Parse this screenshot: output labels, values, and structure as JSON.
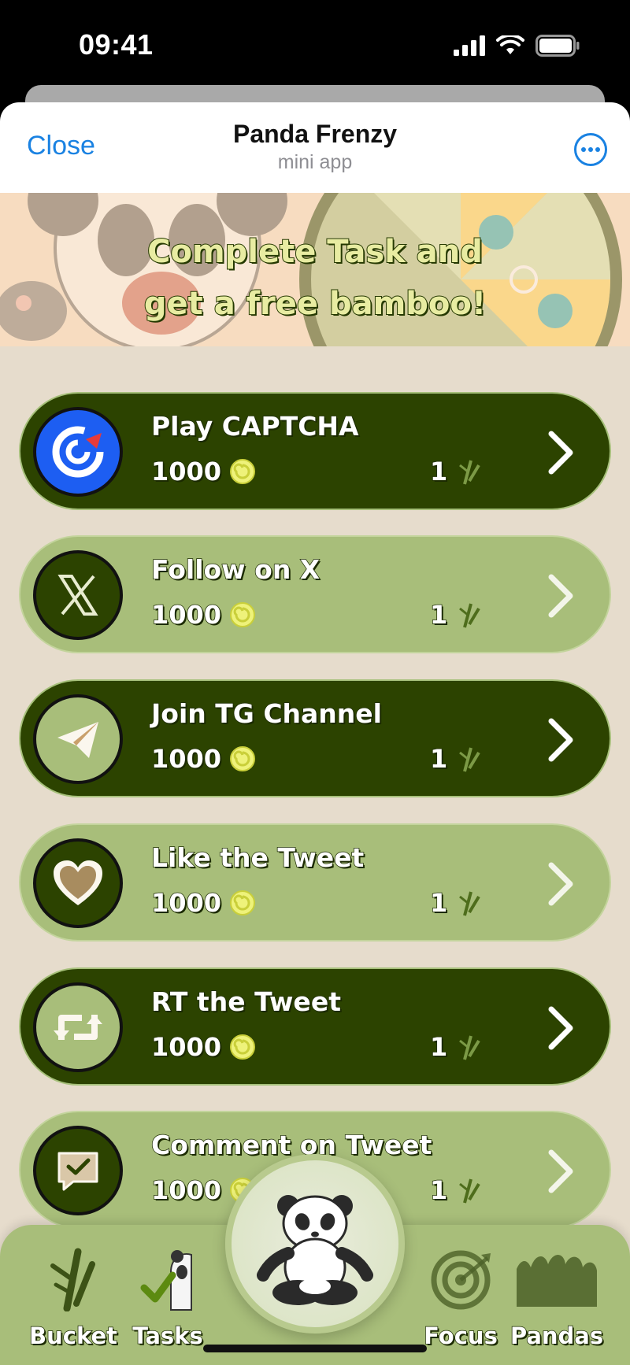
{
  "status_bar": {
    "time": "09:41"
  },
  "header": {
    "close_label": "Close",
    "title": "Panda Frenzy",
    "subtitle": "mini app"
  },
  "banner": {
    "line1": "Complete Task and",
    "line2": "get a free bamboo!"
  },
  "tasks": [
    {
      "name": "Play CAPTCHA",
      "coins": "1000",
      "bamboo": "1",
      "style": "dark",
      "icon": "captcha-icon"
    },
    {
      "name": "Follow on X",
      "coins": "1000",
      "bamboo": "1",
      "style": "light",
      "icon": "x-logo-icon"
    },
    {
      "name": "Join TG Channel",
      "coins": "1000",
      "bamboo": "1",
      "style": "dark",
      "icon": "telegram-icon"
    },
    {
      "name": "Like the Tweet",
      "coins": "1000",
      "bamboo": "1",
      "style": "light",
      "icon": "heart-icon"
    },
    {
      "name": "RT the Tweet",
      "coins": "1000",
      "bamboo": "1",
      "style": "dark",
      "icon": "retweet-icon"
    },
    {
      "name": "Comment on Tweet",
      "coins": "1000",
      "bamboo": "1",
      "style": "light",
      "icon": "comment-icon"
    }
  ],
  "nav": {
    "bucket": "Bucket",
    "tasks": "Tasks",
    "focus": "Focus",
    "pandas": "Pandas"
  },
  "colors": {
    "dark_card": "#2c4300",
    "light_card": "#a8be7a",
    "background": "#e6dccc",
    "accent_blue": "#1a82e2"
  }
}
